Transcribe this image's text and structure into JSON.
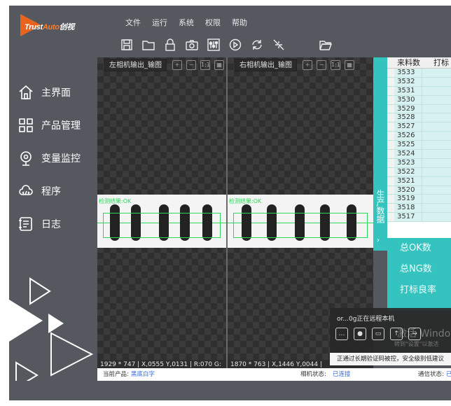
{
  "menu": [
    "文件",
    "运行",
    "系统",
    "权限",
    "帮助"
  ],
  "logo": {
    "text_a": "Trust",
    "text_b": "Auto",
    "text_c": "创视"
  },
  "toolbar": [
    "save-icon",
    "folder-icon",
    "lock-icon",
    "camera-icon",
    "sliders-icon",
    "play-icon",
    "refresh-icon",
    "no-signal-icon",
    "open-folder-icon"
  ],
  "nav": [
    {
      "label": "主界面",
      "icon": "home-icon"
    },
    {
      "label": "产品管理",
      "icon": "grid-icon"
    },
    {
      "label": "变量监控",
      "icon": "monitor-icon"
    },
    {
      "label": "程序",
      "icon": "cloud-program-icon"
    },
    {
      "label": "日志",
      "icon": "log-icon"
    }
  ],
  "panes": {
    "left": {
      "title": "左相机输出_输图",
      "result_label": "检测结果:OK",
      "status": "1929 * 747   | X,0555  Y,0131  | R:070  G:"
    },
    "right": {
      "title": "右相机输出_输图",
      "result_label": "检测结果:OK",
      "status": "1870 * 763   | X,1446  Y,0044  |"
    }
  },
  "production": {
    "tab_label": "生产数据",
    "columns": [
      "来料数",
      "打标"
    ],
    "rows": [
      "3533",
      "3532",
      "3531",
      "3530",
      "3529",
      "3528",
      "3527",
      "3526",
      "3525",
      "3524",
      "3523",
      "3522",
      "3521",
      "3520",
      "3519",
      "3518",
      "3517"
    ],
    "stats": [
      "总OK数",
      "总NG数",
      "打标良率"
    ]
  },
  "notification": {
    "title": "or...0g正在远程本机",
    "watermark_line1": "激活 Windows",
    "watermark_line2": "转到\"设置\"以激活",
    "bar_text": "正通过长期验证码被控，安全级别低建议"
  },
  "statusbar": {
    "product_label": "当前产品:",
    "product_value": "黑底白字",
    "camera_label": "相机状态:",
    "camera_value": "已连接",
    "comm_label": "通信状态:",
    "comm_value": "已"
  },
  "colors": {
    "accent": "#35c3bf",
    "logo_orange": "#e8641e",
    "background": "#55585f"
  }
}
